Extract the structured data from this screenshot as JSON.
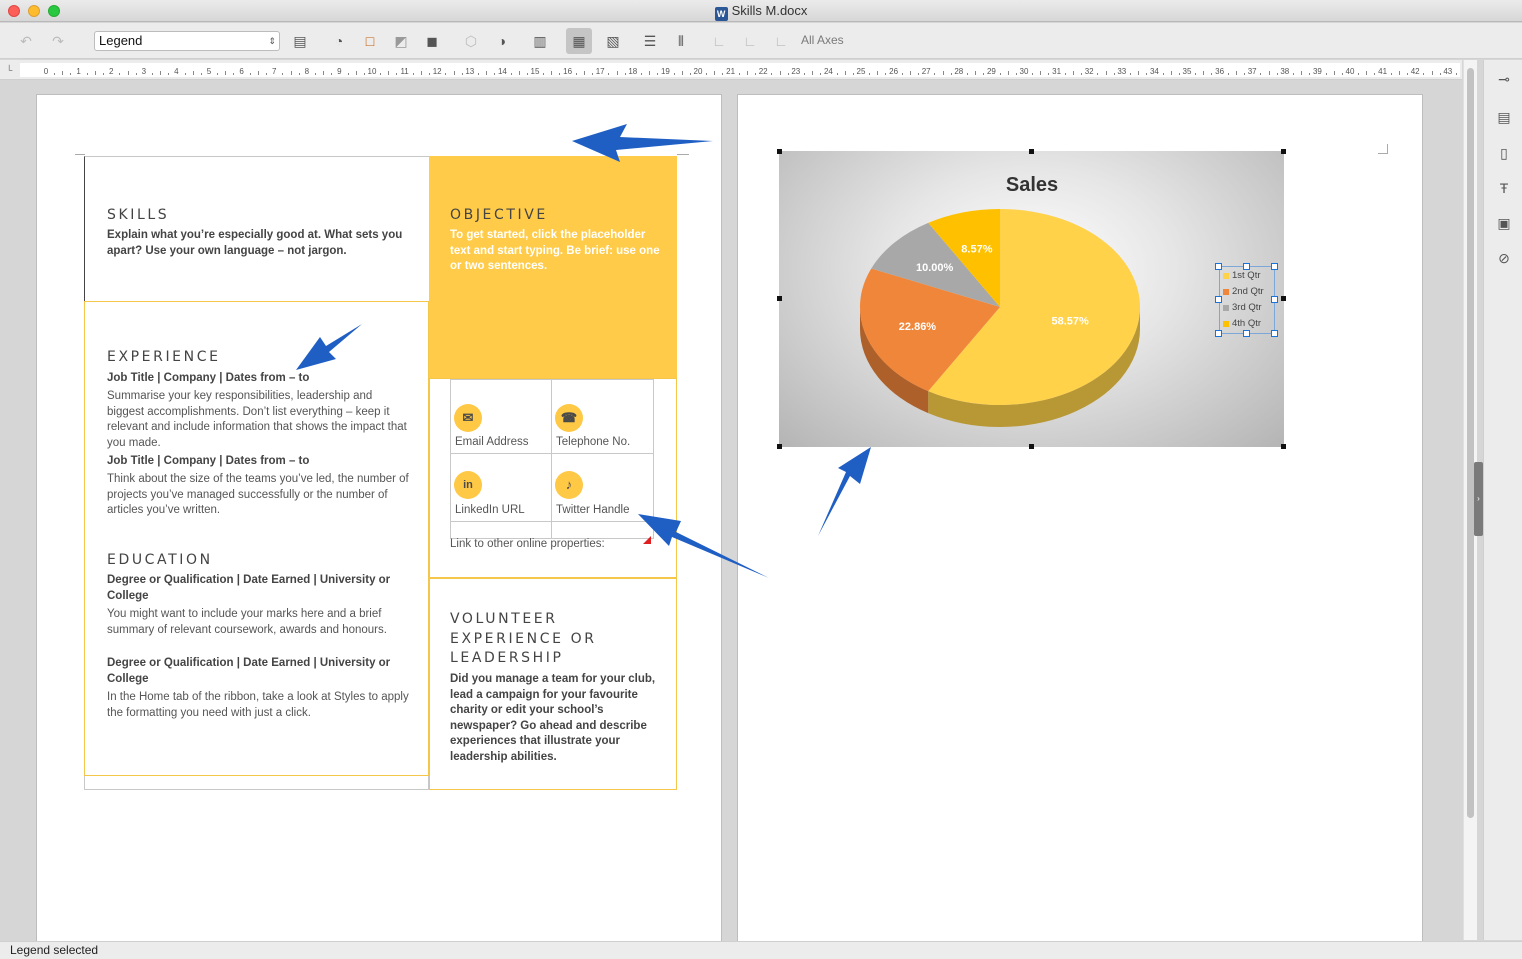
{
  "window": {
    "title": "Skills M.docx"
  },
  "toolbar": {
    "element_select": "Legend",
    "all_axes_label": "All Axes"
  },
  "ruler": {
    "labels": [
      "0",
      "1",
      "2",
      "3",
      "4",
      "5",
      "6",
      "7",
      "8",
      "9",
      "10",
      "11",
      "12",
      "13",
      "14",
      "15",
      "16",
      "17",
      "18",
      "19",
      "20",
      "21",
      "22",
      "23",
      "24",
      "25",
      "26",
      "27",
      "28",
      "29",
      "30",
      "31",
      "32",
      "33",
      "34",
      "35",
      "36",
      "37",
      "38",
      "39",
      "40",
      "41",
      "42",
      "43"
    ]
  },
  "resume": {
    "skills": {
      "heading": "SKILLS",
      "body": "Explain what you’re especially good at. What sets you apart? Use your own language – not jargon."
    },
    "objective": {
      "heading": "OBJECTIVE",
      "body": "To get started, click the placeholder text and start typing. Be brief: use one or two sentences."
    },
    "experience": {
      "heading": "EXPERIENCE",
      "job1_title": "Job Title | Company | Dates from – to",
      "job1_body": "Summarise your key responsibilities, leadership and biggest accomplishments. Don’t list everything – keep it relevant and include information that shows the impact that you made.",
      "job2_title": "Job Title | Company | Dates from – to",
      "job2_body": "Think about the size of the teams you’ve led, the number of projects you’ve managed successfully or the number of articles you’ve written."
    },
    "education": {
      "heading": "EDUCATION",
      "deg1_title": "Degree or Qualification | Date Earned | University or College",
      "deg1_body": "You might want to include your marks here and a brief summary of relevant coursework, awards and honours.",
      "deg2_title": "Degree or Qualification | Date Earned | University or College",
      "deg2_body": "In the Home tab of the ribbon, take a look at Styles to apply the formatting you need with just a click."
    },
    "contact": {
      "email": "Email Address",
      "phone": "Telephone No.",
      "linkedin": "LinkedIn URL",
      "twitter": "Twitter Handle",
      "other": "Link to other online properties:"
    },
    "volunteer": {
      "heading_line1": "VOLUNTEER",
      "heading_line2": "EXPERIENCE OR",
      "heading_line3": "LEADERSHIP",
      "body": "Did you manage a team for your club, lead a campaign for your favourite charity or edit your school’s newspaper? Go ahead and describe experiences that illustrate your leadership abilities."
    }
  },
  "chart_data": {
    "type": "pie",
    "title": "Sales",
    "categories": [
      "1st Qtr",
      "2nd Qtr",
      "3rd Qtr",
      "4th Qtr"
    ],
    "values": [
      58.57,
      22.86,
      10.0,
      8.57
    ],
    "data_labels": [
      "58.57%",
      "22.86%",
      "10.00%",
      "8.57%"
    ],
    "colors": [
      "#ffd24a",
      "#f0863a",
      "#a8a8a8",
      "#ffc000"
    ],
    "legend_position": "right"
  },
  "status": {
    "text": "Legend selected"
  },
  "colors": {
    "accent": "#ffc845",
    "arrow": "#1f5fc4"
  }
}
